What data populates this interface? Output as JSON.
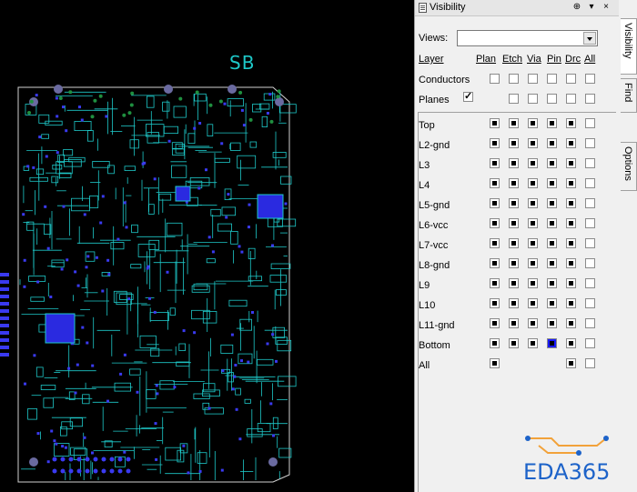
{
  "canvas": {
    "board_label": "SB",
    "trace_color": "#1ec8c8",
    "pad_color": "#3a3af0",
    "outline_color": "#d0d0d0"
  },
  "panel": {
    "title": "Visibility",
    "pin_button": "⊕",
    "menu_button": "▾",
    "close_button": "×",
    "tabs": [
      "Visibility",
      "Find",
      "Options"
    ],
    "views_label": "Views:",
    "views_value": "",
    "columns": {
      "layer": "Layer",
      "plan": "Plan",
      "etch": "Etch",
      "via": "Via",
      "pin": "Pin",
      "drc": "Drc",
      "all": "All"
    },
    "global_rows": [
      {
        "label": "Conductors",
        "visible": false
      },
      {
        "label": "Planes",
        "visible": true
      }
    ],
    "layers": [
      {
        "label": "Top"
      },
      {
        "label": "L2-gnd"
      },
      {
        "label": "L3"
      },
      {
        "label": "L4"
      },
      {
        "label": "L5-gnd"
      },
      {
        "label": "L6-vcc"
      },
      {
        "label": "L7-vcc"
      },
      {
        "label": "L8-gnd"
      },
      {
        "label": "L9"
      },
      {
        "label": "L10"
      },
      {
        "label": "L11-gnd"
      },
      {
        "label": "Bottom"
      },
      {
        "label": "All"
      }
    ]
  },
  "logo": {
    "text": "EDA365",
    "color": "#1d63c9",
    "accent": "#f2a23a"
  }
}
